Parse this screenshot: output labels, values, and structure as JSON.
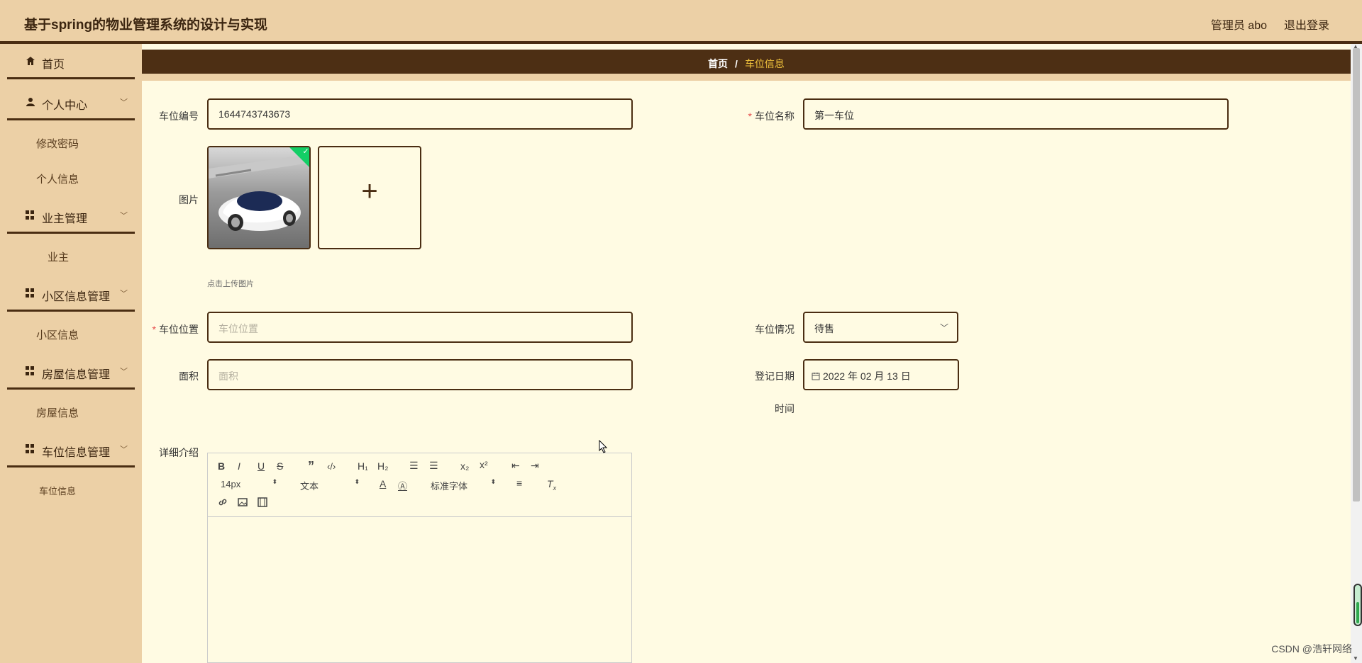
{
  "header": {
    "title": "基于spring的物业管理系统的设计与实现",
    "user": "管理员 abo",
    "logout": "退出登录"
  },
  "sidebar": {
    "home": "首页",
    "personal_center": "个人中心",
    "change_password": "修改密码",
    "personal_info": "个人信息",
    "owner_mgmt": "业主管理",
    "owner": "业主",
    "community_mgmt": "小区信息管理",
    "community_info": "小区信息",
    "house_mgmt": "房屋信息管理",
    "house_info": "房屋信息",
    "parking_mgmt": "车位信息管理",
    "parking_info": "车位信息"
  },
  "breadcrumb": {
    "home": "首页",
    "separator": "/",
    "current": "车位信息"
  },
  "form": {
    "space_no_label": "车位编号",
    "space_no_value": "1644743743673",
    "space_name_label": "车位名称",
    "space_name_value": "第一车位",
    "image_label": "图片",
    "upload_hint": "点击上传图片",
    "location_label": "车位位置",
    "location_placeholder": "车位位置",
    "status_label": "车位情况",
    "status_value": "待售",
    "area_label": "面积",
    "area_placeholder": "面积",
    "reg_date_label": "登记日期",
    "reg_date_value": "2022 年 02 月 13 日",
    "time_label": "时间",
    "detail_label": "详细介绍"
  },
  "editor": {
    "font_size": "14px",
    "text_style": "文本",
    "font_family": "标准字体"
  },
  "watermark": "CSDN @浩轩网络",
  "colors": {
    "header_bg": "#ecd0a6",
    "accent_dark": "#4a2d12",
    "content_bg": "#fffbe3",
    "breadcrumb_current": "#f0c23c",
    "required": "#e64b4b"
  }
}
